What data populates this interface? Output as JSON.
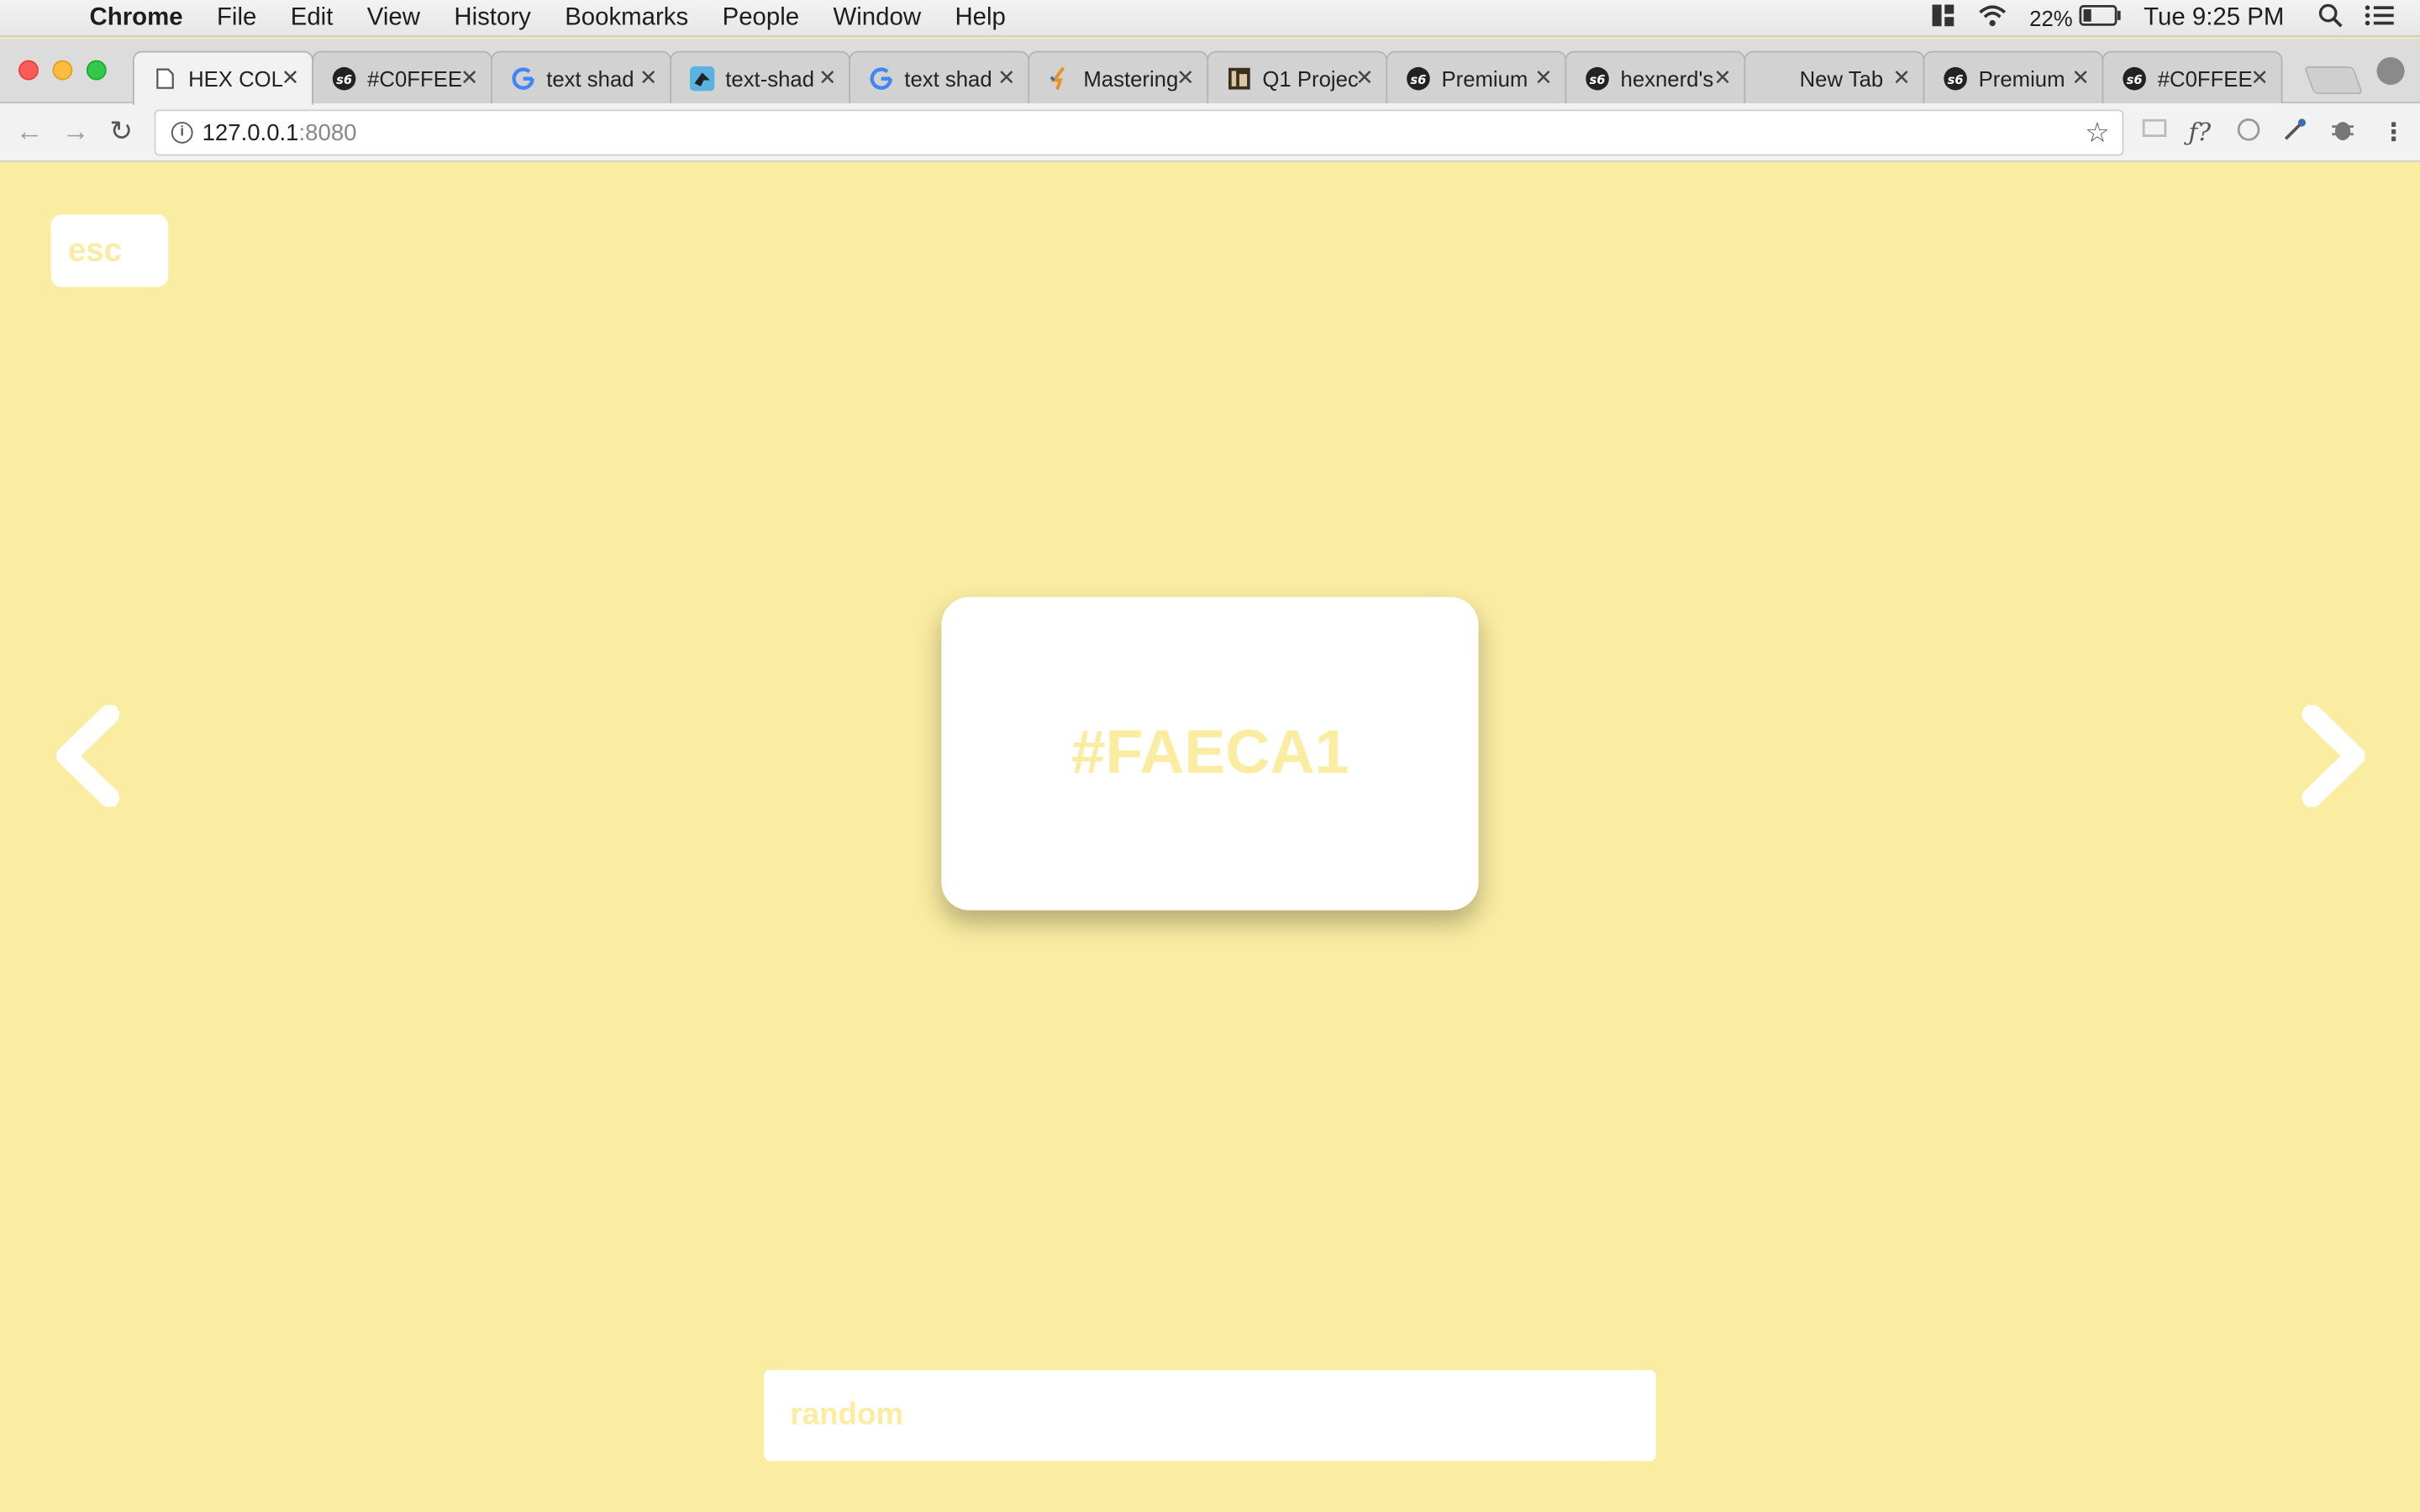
{
  "menubar": {
    "items": [
      "Chrome",
      "File",
      "Edit",
      "View",
      "History",
      "Bookmarks",
      "People",
      "Window",
      "Help"
    ],
    "battery": "22%",
    "clock": "Tue 9:25 PM"
  },
  "tabs": [
    {
      "title": "HEX COL",
      "icon": "document-icon"
    },
    {
      "title": "#C0FFEE",
      "icon": "so-icon"
    },
    {
      "title": "text shad",
      "icon": "google-icon"
    },
    {
      "title": "text-shad",
      "icon": "bird-icon"
    },
    {
      "title": "text shad",
      "icon": "google-icon"
    },
    {
      "title": "Mastering",
      "icon": "spark-icon"
    },
    {
      "title": "Q1 Projec",
      "icon": "doc-icon"
    },
    {
      "title": "Premium",
      "icon": "so-icon"
    },
    {
      "title": "hexnerd's",
      "icon": "so-icon"
    },
    {
      "title": "New Tab",
      "icon": ""
    },
    {
      "title": "Premium",
      "icon": "so-icon"
    },
    {
      "title": "#C0FFEE",
      "icon": "so-icon"
    }
  ],
  "address": {
    "host": "127.0.0.1",
    "port": ":8080"
  },
  "page": {
    "esc_label": "esc",
    "hex_code": "#FAECA1",
    "random_label": "random",
    "background_color": "#FAECA1"
  }
}
